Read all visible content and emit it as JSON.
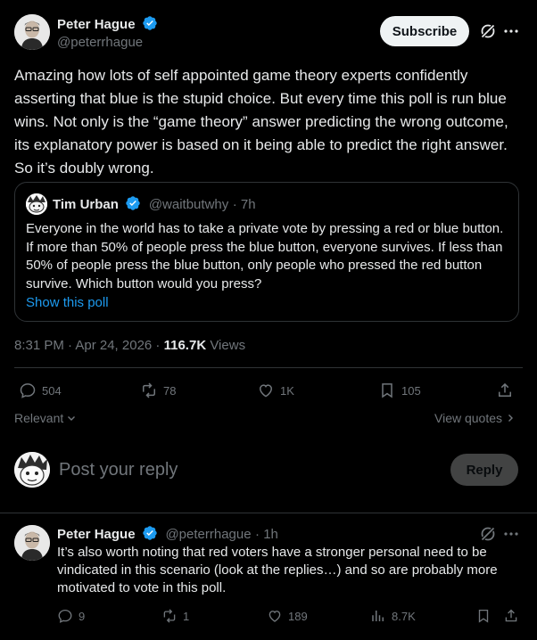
{
  "main_post": {
    "author_name": "Peter Hague",
    "author_handle": "@peterrhague",
    "subscribe_label": "Subscribe",
    "text": "Amazing how lots of self appointed game theory experts confidently asserting that blue is the stupid choice. But every time this poll is run blue wins. Not only is the “game theory” answer predicting the wrong outcome, its explanatory power is based on it being able to predict the right answer. So it’s doubly wrong.",
    "quote": {
      "author_name": "Tim Urban",
      "author_handle": "@waitbutwhy",
      "time": "· 7h",
      "text": "Everyone in the world has to take a private vote by pressing a red or blue button. If more than 50% of people press the blue button, everyone survives. If less than 50% of people press the blue button, only people who pressed the red button survive. Which button would you press?",
      "show_poll": "Show this poll"
    },
    "timestamp": "8:31 PM · Apr 24, 2026 ·",
    "views_count": "116.7K",
    "views_label": "Views",
    "actions": {
      "replies": "504",
      "reposts": "78",
      "likes": "1K",
      "bookmarks": "105"
    },
    "relevant_label": "Relevant",
    "view_quotes_label": "View quotes"
  },
  "reply_box": {
    "placeholder": "Post your reply",
    "button_label": "Reply"
  },
  "reply_post": {
    "author_name": "Peter Hague",
    "author_handle": "@peterrhague",
    "time": "· 1h",
    "text": "It’s also worth noting that red voters have a stronger personal need to be vindicated in this scenario (look at the replies…) and so are probably more motivated to vote in this poll.",
    "actions": {
      "replies": "9",
      "reposts": "1",
      "likes": "189",
      "views": "8.7K"
    }
  },
  "colors": {
    "accent": "#1d9bf0",
    "background": "#000000",
    "muted": "#71767b",
    "text": "#e7e9ea",
    "border": "#2f3336"
  }
}
